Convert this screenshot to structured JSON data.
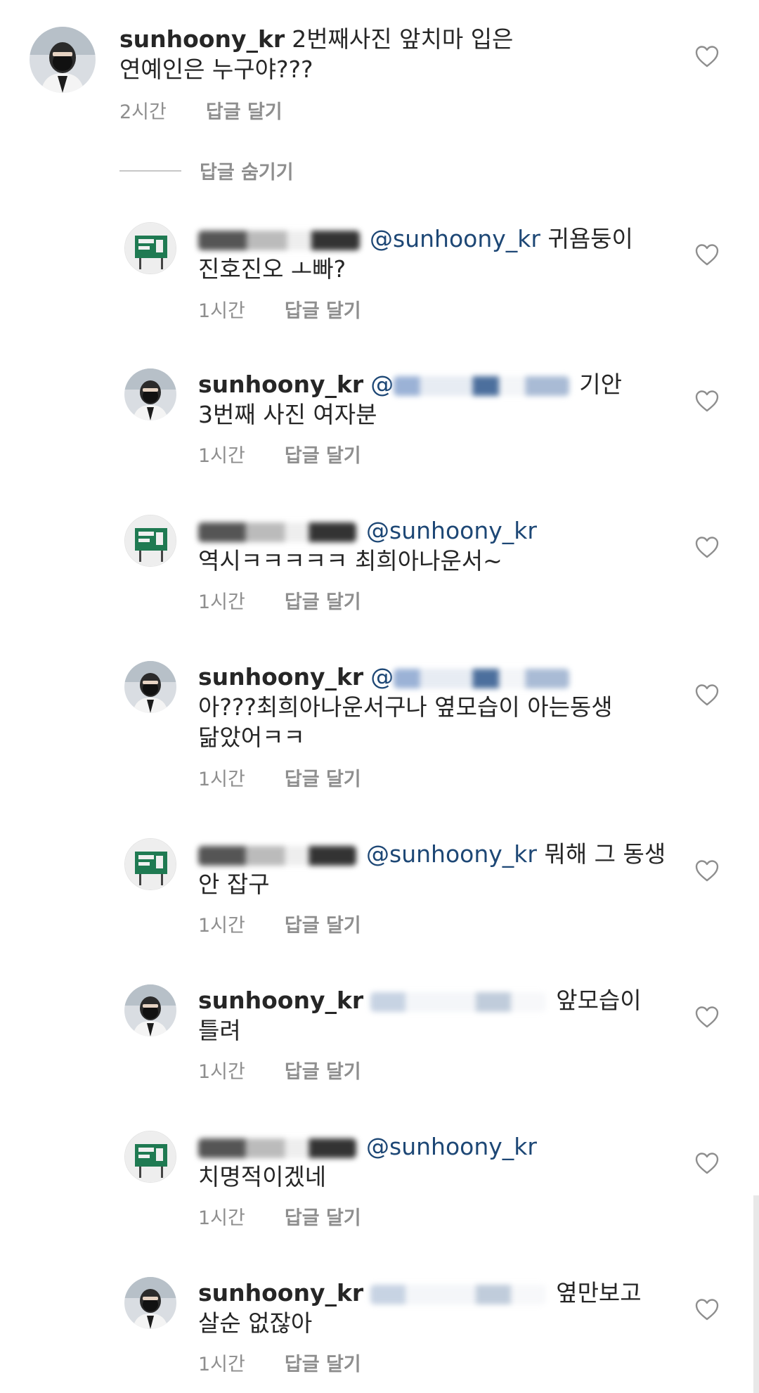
{
  "main_comment": {
    "username": "sunhoony_kr",
    "text": "2번째사진 앞치마 입은 연예인은 누구야???",
    "time": "2시간",
    "reply_label": "답글 달기"
  },
  "hide_replies_label": "답글 숨기기",
  "replies": [
    {
      "avatar": "sign",
      "username": "",
      "mention": "@sunhoony_kr",
      "text": "귀욤둥이 진호진오 ㅗ빠?",
      "time": "1시간",
      "reply_label": "답글 달기",
      "blur": "gray"
    },
    {
      "avatar": "person",
      "username": "sunhoony_kr",
      "mention": "@",
      "text": "기안 3번째 사진 여자분",
      "time": "1시간",
      "reply_label": "답글 달기",
      "blur": "blue"
    },
    {
      "avatar": "sign",
      "username": "",
      "mention": "@sunhoony_kr",
      "text": "역시ㅋㅋㅋㅋㅋ 최희아나운서~",
      "time": "1시간",
      "reply_label": "답글 달기",
      "blur": "gray"
    },
    {
      "avatar": "person",
      "username": "sunhoony_kr",
      "mention": "@",
      "text": "아???최희아나운서구나 옆모습이 아는동생 닮았어ㅋㅋ",
      "time": "1시간",
      "reply_label": "답글 달기",
      "blur": "blue"
    },
    {
      "avatar": "sign",
      "username": "",
      "mention": "@sunhoony_kr",
      "text": "뭐해 그 동생 안 잡구",
      "time": "1시간",
      "reply_label": "답글 달기",
      "blur": "gray"
    },
    {
      "avatar": "person",
      "username": "sunhoony_kr",
      "mention": "",
      "text": "앞모습이 틀려",
      "time": "1시간",
      "reply_label": "답글 달기",
      "blur": "light"
    },
    {
      "avatar": "sign",
      "username": "",
      "mention": "@sunhoony_kr",
      "text": "치명적이겠네",
      "time": "1시간",
      "reply_label": "답글 달기",
      "blur": "gray"
    },
    {
      "avatar": "person",
      "username": "sunhoony_kr",
      "mention": "",
      "text": "옆만보고 살순 없잖아",
      "time": "1시간",
      "reply_label": "답글 달기",
      "blur": "light"
    }
  ],
  "icons": {
    "like": "heart-icon"
  },
  "colors": {
    "mention": "#1d4775",
    "meta": "#8e8e8e",
    "text": "#262626"
  }
}
